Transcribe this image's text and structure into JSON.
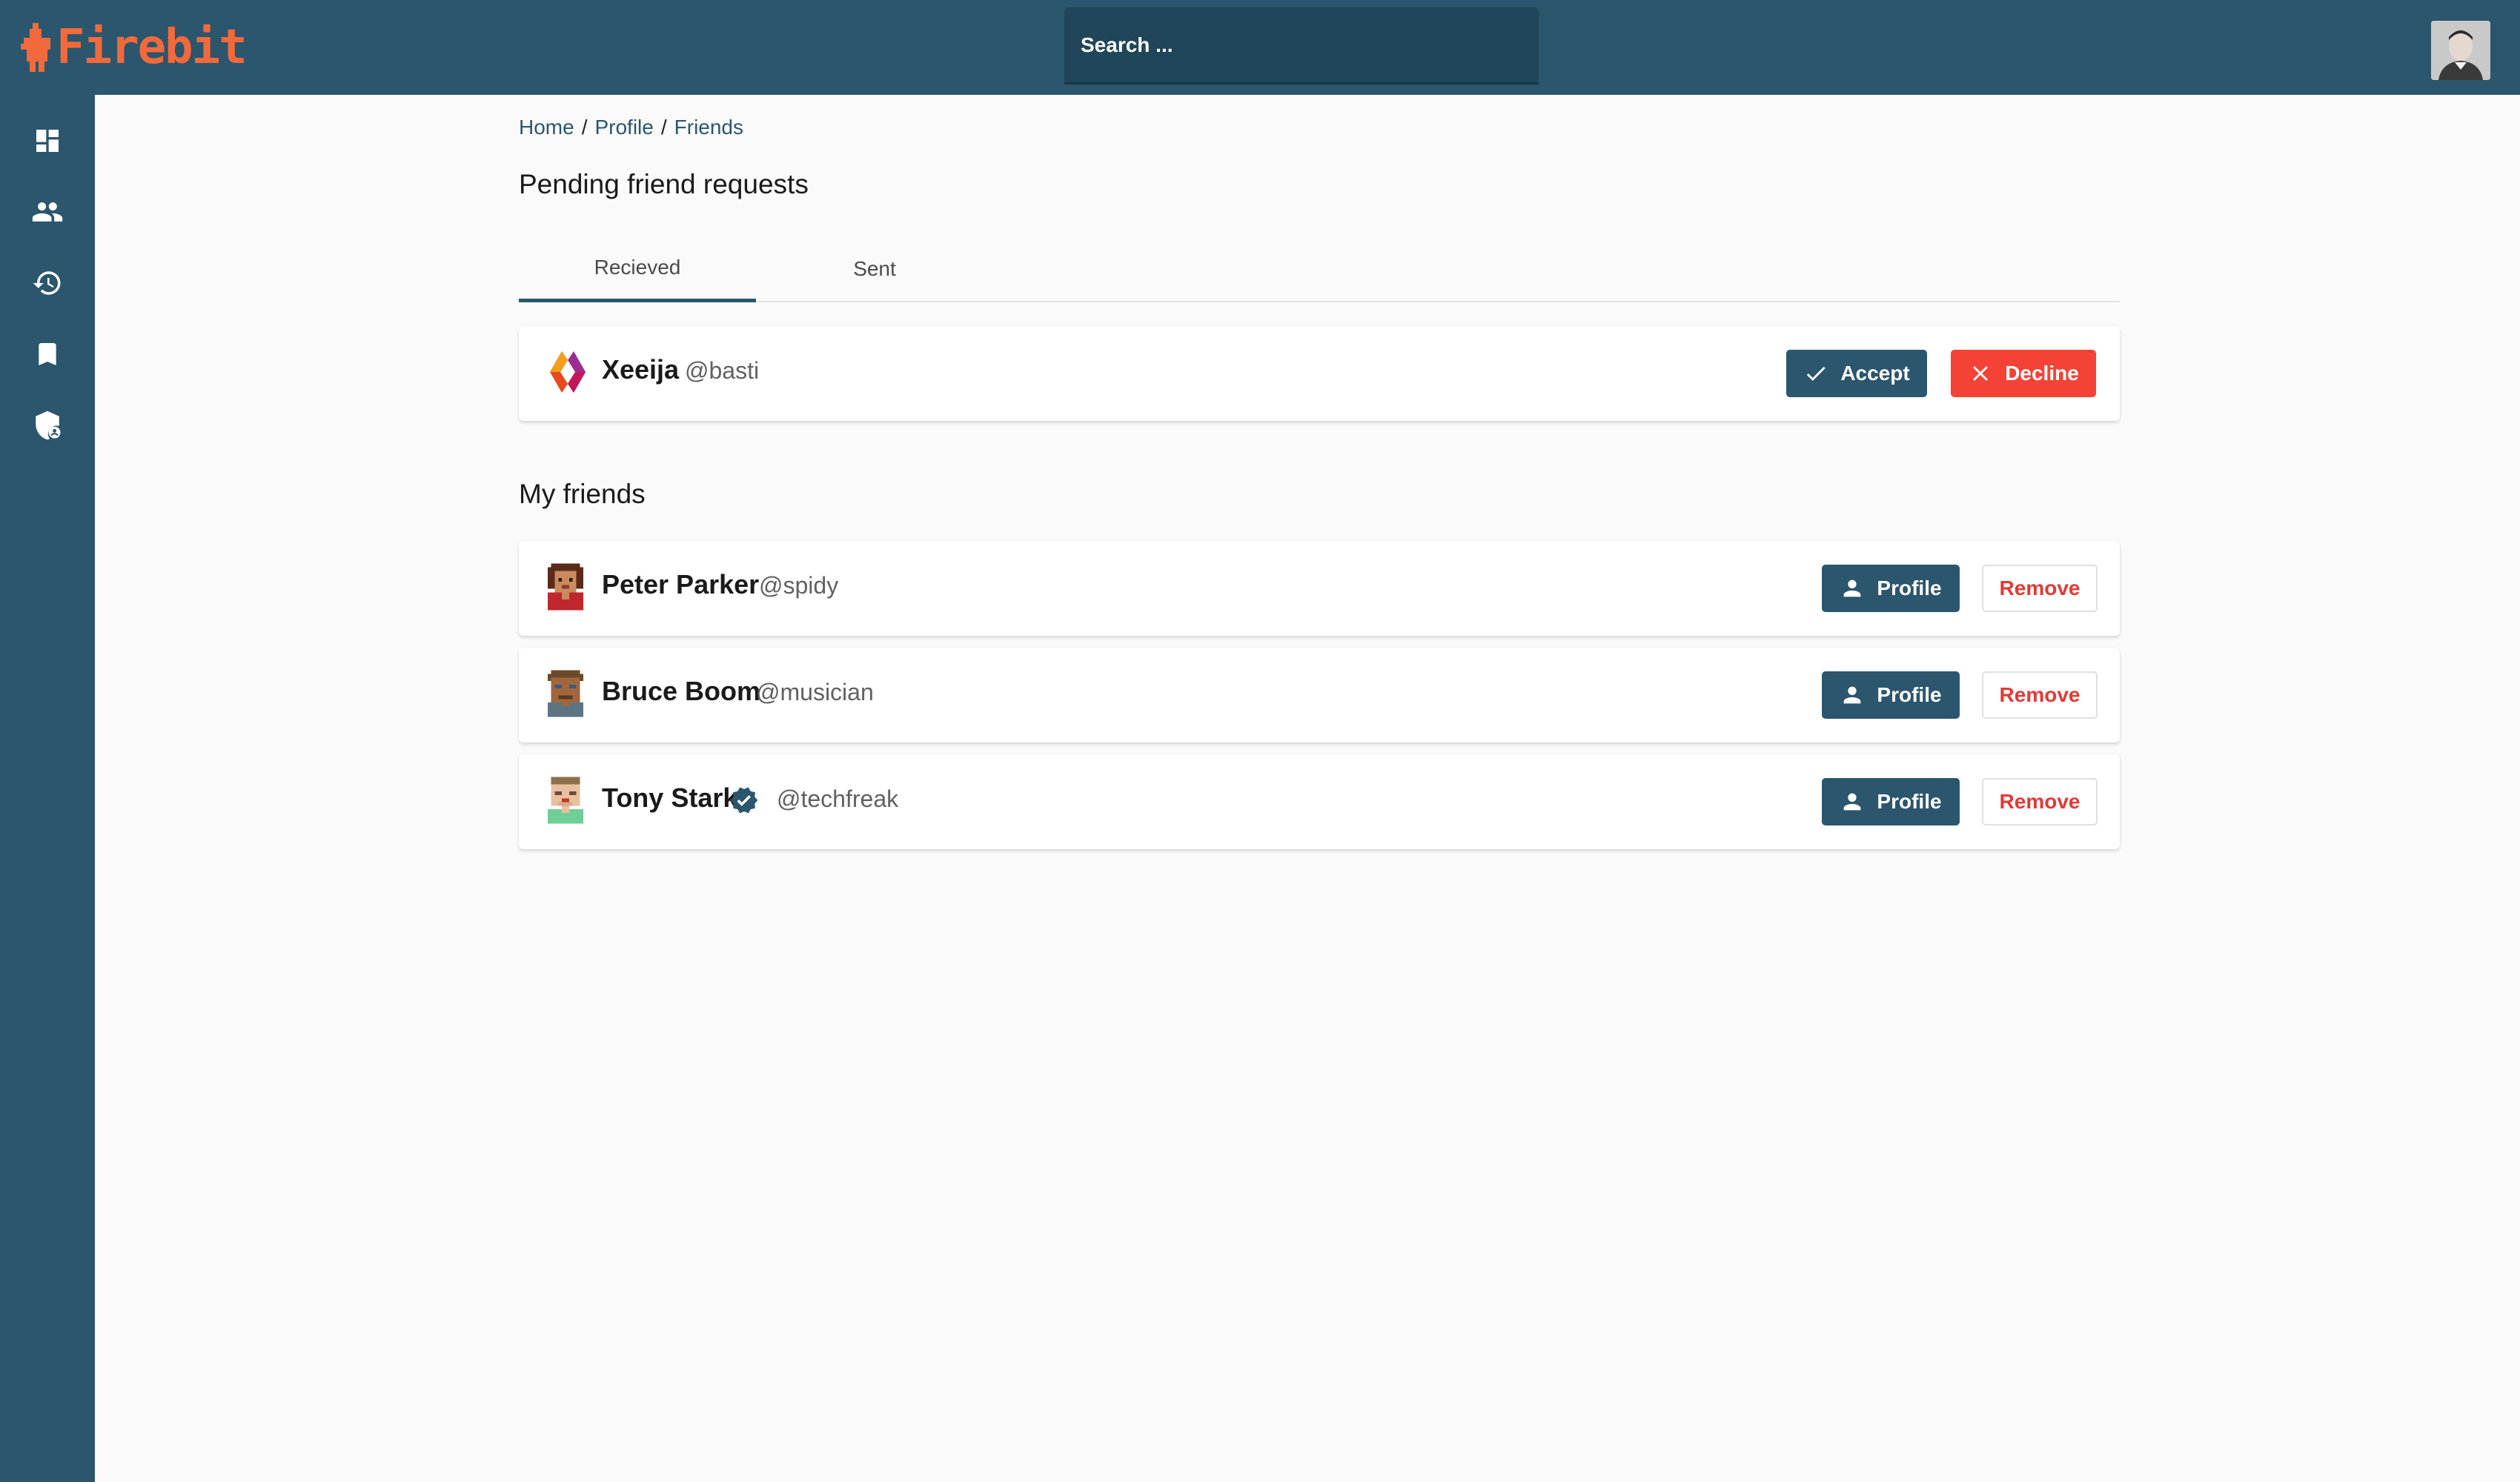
{
  "app": {
    "brand": "Firebit",
    "brand_color": "#f26a3c",
    "bar_color": "#2b566d"
  },
  "search": {
    "placeholder": "Search ..."
  },
  "sidebar": {
    "items": [
      {
        "icon": "dashboard-icon"
      },
      {
        "icon": "people-icon"
      },
      {
        "icon": "history-icon"
      },
      {
        "icon": "bookmark-icon"
      },
      {
        "icon": "admin-shield-icon"
      }
    ]
  },
  "breadcrumb": {
    "home": "Home",
    "profile": "Profile",
    "current": "Friends",
    "separator": "/"
  },
  "pending": {
    "title": "Pending friend requests",
    "tabs": {
      "received": "Recieved",
      "sent": "Sent"
    },
    "requests": [
      {
        "name": "Xeeija",
        "handle": "@basti",
        "accept_label": "Accept",
        "decline_label": "Decline"
      }
    ]
  },
  "friends": {
    "title": "My friends",
    "items": [
      {
        "name": "Peter Parker",
        "handle": "@spidy",
        "verified": false,
        "profile_label": "Profile",
        "remove_label": "Remove"
      },
      {
        "name": "Bruce Boom",
        "handle": "@musician",
        "verified": false,
        "profile_label": "Profile",
        "remove_label": "Remove"
      },
      {
        "name": "Tony Stark",
        "handle": "@techfreak",
        "verified": true,
        "profile_label": "Profile",
        "remove_label": "Remove"
      }
    ]
  }
}
